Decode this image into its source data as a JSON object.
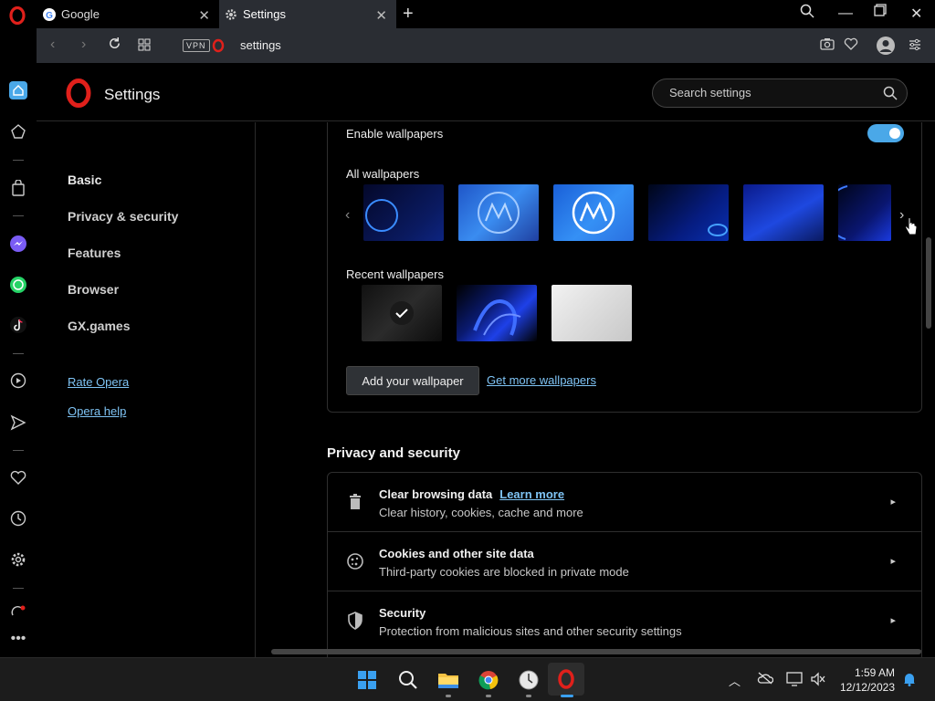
{
  "tabs": [
    {
      "title": "Google",
      "icon": "google-icon"
    },
    {
      "title": "Settings",
      "icon": "gear-icon"
    }
  ],
  "addressbar": {
    "vpn": "VPN",
    "url": "settings"
  },
  "header": {
    "title": "Settings",
    "search_placeholder": "Search settings"
  },
  "nav": {
    "items": [
      "Basic",
      "Privacy & security",
      "Features",
      "Browser",
      "GX.games"
    ],
    "links": [
      "Rate Opera",
      "Opera help"
    ]
  },
  "wallpapers": {
    "enable_label": "Enable wallpapers",
    "enabled": true,
    "all_label": "All wallpapers",
    "recent_label": "Recent wallpapers",
    "add_button": "Add your wallpaper",
    "get_more": "Get more wallpapers"
  },
  "privacy": {
    "heading": "Privacy and security",
    "rows": [
      {
        "title": "Clear browsing data",
        "link": "Learn more",
        "desc": "Clear history, cookies, cache and more",
        "icon": "trash-icon"
      },
      {
        "title": "Cookies and other site data",
        "desc": "Third-party cookies are blocked in private mode",
        "icon": "cookie-icon"
      },
      {
        "title": "Security",
        "desc": "Protection from malicious sites and other security settings",
        "icon": "shield-icon"
      }
    ]
  },
  "taskbar": {
    "time": "1:59 AM",
    "date": "12/12/2023"
  },
  "colors": {
    "accent": "#4aa8e8",
    "link": "#7fc4f5",
    "opera_red": "#e0201b"
  }
}
